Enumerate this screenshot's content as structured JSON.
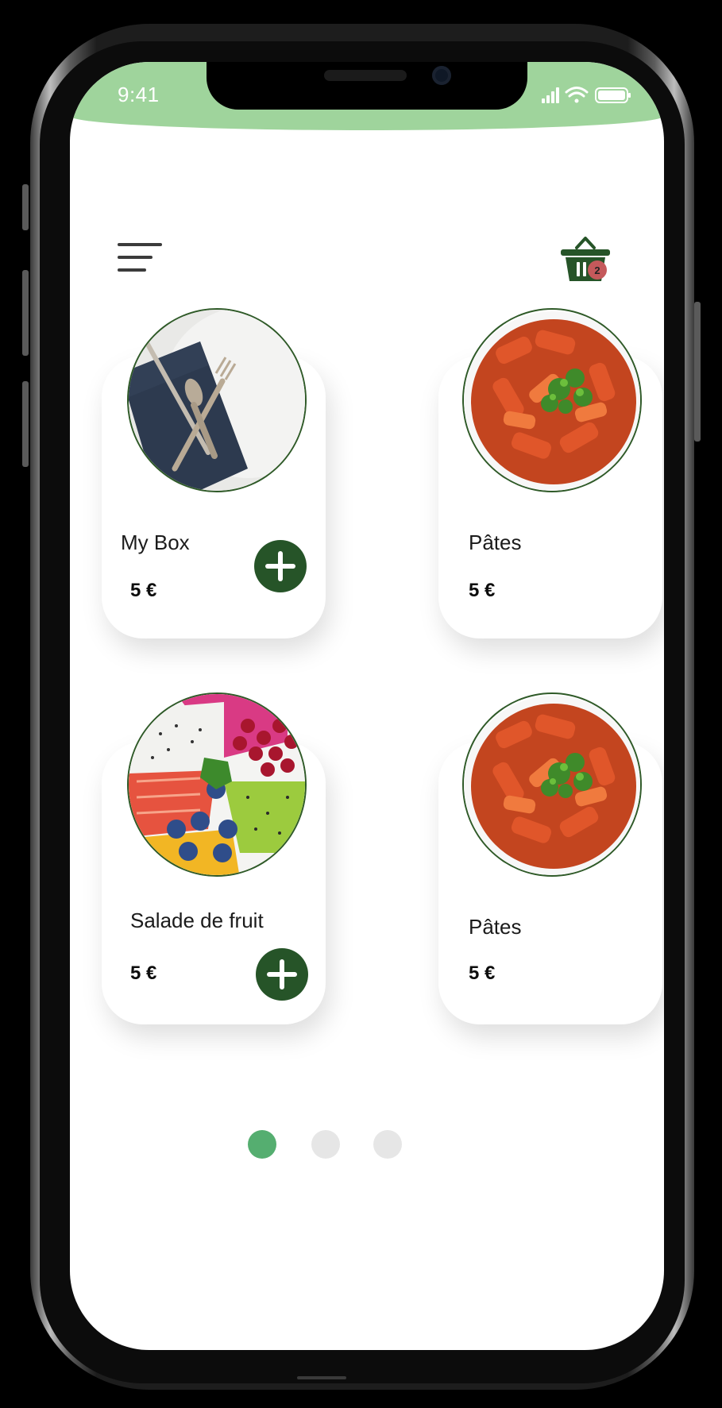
{
  "status_bar": {
    "time": "9:41",
    "accent": "#9fd49c"
  },
  "header": {
    "menu_icon": "hamburger-menu-icon",
    "cart_icon": "shopping-basket-icon",
    "cart_count": "2",
    "cart_badge_color": "#c5595b"
  },
  "products": [
    {
      "name": "My Box",
      "price": "5 €",
      "image": "cutlery-on-napkin"
    },
    {
      "name": "Pâtes",
      "price": "5 €",
      "image": "pasta-bowl"
    },
    {
      "name": "Salade de fruit",
      "price": "5 €",
      "image": "fruit-bowl"
    },
    {
      "name": "Pâtes",
      "price": "5 €",
      "image": "pasta-bowl"
    }
  ],
  "pagination": {
    "total": 3,
    "active_index": 0,
    "active_color": "#55ae70",
    "inactive_color": "#e6e6e6"
  },
  "colors": {
    "brand_dark_green": "#265428",
    "status_green": "#9fd49c"
  }
}
